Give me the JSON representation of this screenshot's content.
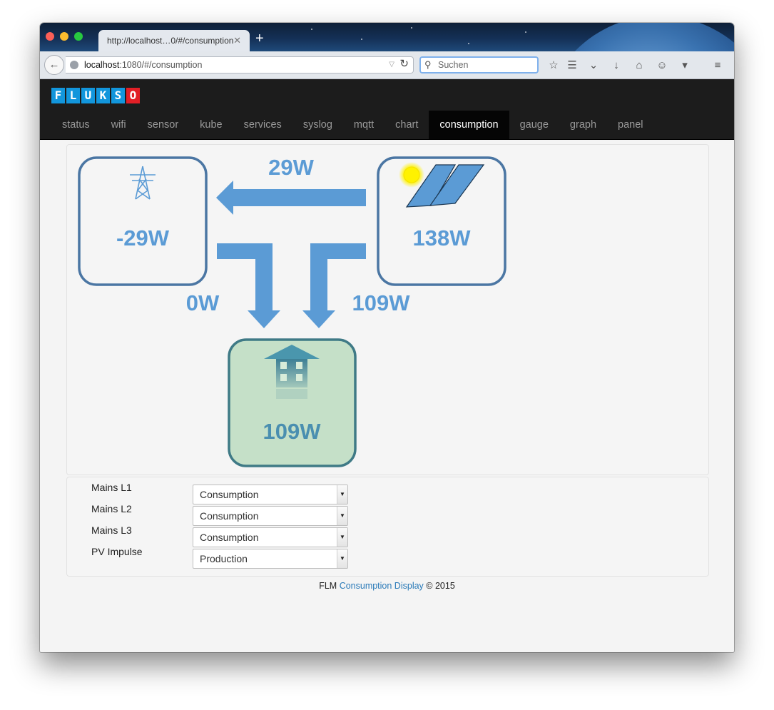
{
  "browser": {
    "tab_title": "http://localhost…0/#/consumption",
    "url_host": "localhost",
    "url_rest": ":1080/#/consumption",
    "search_placeholder": "Suchen"
  },
  "app": {
    "logo_letters": [
      "F",
      "L",
      "U",
      "K",
      "S",
      "O"
    ],
    "nav": [
      {
        "label": "status"
      },
      {
        "label": "wifi"
      },
      {
        "label": "sensor"
      },
      {
        "label": "kube"
      },
      {
        "label": "services"
      },
      {
        "label": "syslog"
      },
      {
        "label": "mqtt"
      },
      {
        "label": "chart"
      },
      {
        "label": "consumption",
        "active": true
      },
      {
        "label": "gauge"
      },
      {
        "label": "graph"
      },
      {
        "label": "panel"
      }
    ]
  },
  "flow": {
    "grid_power": "-29W",
    "solar_power": "138W",
    "house_power": "109W",
    "solar_to_grid": "29W",
    "grid_to_house": "0W",
    "solar_to_house": "109W"
  },
  "sensors": [
    {
      "label": "Mains L1",
      "value": "Consumption"
    },
    {
      "label": "Mains L2",
      "value": "Consumption"
    },
    {
      "label": "Mains L3",
      "value": "Consumption"
    },
    {
      "label": "PV Impulse",
      "value": "Production"
    }
  ],
  "footer": {
    "prefix": "FLM",
    "link": "Consumption Display",
    "suffix": "© 2015"
  },
  "colors": {
    "accent_blue": "#5b9bd5",
    "box_border": "#4b76a3",
    "house_fill": "#c5e0c8",
    "house_border": "#3f7a86",
    "logo_blue": "#1296dc",
    "logo_red": "#e21f26"
  }
}
